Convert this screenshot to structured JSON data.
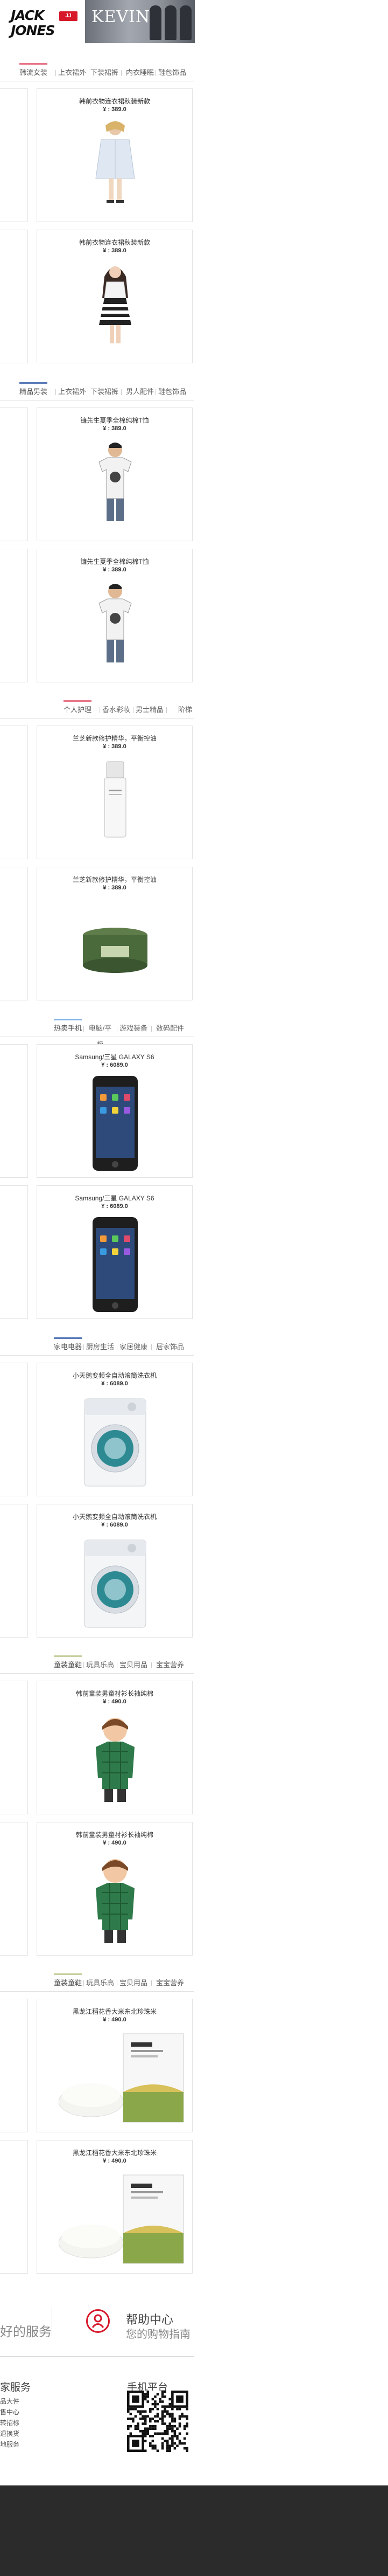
{
  "header": {
    "logo_line1": "JACK",
    "logo_line2": "JONES",
    "logo_badge": "JJ",
    "banner_text": "KEVIN"
  },
  "floors": [
    {
      "tabs": [
        "韩流女装",
        "上衣裙外",
        "下装裙裤",
        "内衣睡眠",
        "鞋包饰品"
      ],
      "accent": "#e8768a",
      "products": [
        {
          "name": "韩前衣物连衣裙秋装新款",
          "price": "¥ : 389.0"
        },
        {
          "name": "韩前衣物连衣裙秋装新款",
          "price": "¥ : 389.0"
        }
      ]
    },
    {
      "tabs": [
        "精品男装",
        "上衣裙外",
        "下装裙裤",
        "男人配件",
        "鞋包饰品"
      ],
      "accent": "#5a7ab8",
      "products": [
        {
          "name": "镰先生夏季全棉纯棉T恤",
          "price": "¥ : 389.0"
        },
        {
          "name": "镰先生夏季全棉纯棉T恤",
          "price": "¥ : 389.0"
        }
      ]
    },
    {
      "tabs": [
        "个人护理",
        "香水彩妆",
        "男士精品",
        "阶梯"
      ],
      "accent": "#e8768a",
      "products": [
        {
          "name": "兰芝新款修护精华，平衡控油",
          "price": "¥ : 389.0"
        },
        {
          "name": "兰芝新款修护精华，平衡控油",
          "price": "¥ : 389.0"
        }
      ]
    },
    {
      "tabs": [
        "热卖手机",
        "电脑/平板",
        "游戏装备",
        "数码配件"
      ],
      "accent": "#7fb3e6",
      "products": [
        {
          "name": "Samsung/三星 GALAXY S6",
          "price": "¥ : 6089.0"
        },
        {
          "name": "Samsung/三星 GALAXY S6",
          "price": "¥ : 6089.0"
        }
      ]
    },
    {
      "tabs": [
        "家电电器",
        "厨房生活",
        "家居健康",
        "居家饰品"
      ],
      "accent": "#5a7ab8",
      "products": [
        {
          "name": "小天鹅变频全自动滚筒洗衣机",
          "price": "¥ : 6089.0"
        },
        {
          "name": "小天鹅变频全自动滚筒洗衣机",
          "price": "¥ : 6089.0"
        }
      ]
    },
    {
      "tabs": [
        "童装童鞋",
        "玩具乐高",
        "宝贝用品",
        "宝宝营养"
      ],
      "accent": "#c8cfa0",
      "products": [
        {
          "name": "韩前童装男童衬衫长袖纯棉",
          "price": "¥ : 490.0"
        },
        {
          "name": "韩前童装男童衬衫长袖纯棉",
          "price": "¥ : 490.0"
        }
      ]
    },
    {
      "tabs": [
        "童装童鞋",
        "玩具乐高",
        "宝贝用品",
        "宝宝营养"
      ],
      "accent": "#c8cfa0",
      "products": [
        {
          "name": "黑龙江稻花香大米东北珍珠米",
          "price": "¥ : 490.0"
        },
        {
          "name": "黑龙江稻花香大米东北珍珠米",
          "price": "¥ : 490.0"
        }
      ]
    }
  ],
  "footer": {
    "left_text": "好的服务",
    "help_title": "帮助中心",
    "help_sub": "您的购物指南",
    "service_heading": "家服务",
    "service_links": [
      "品大件",
      "售中心",
      "转招标",
      "退换货",
      "地服务"
    ],
    "mobile_heading": "手机平台"
  }
}
